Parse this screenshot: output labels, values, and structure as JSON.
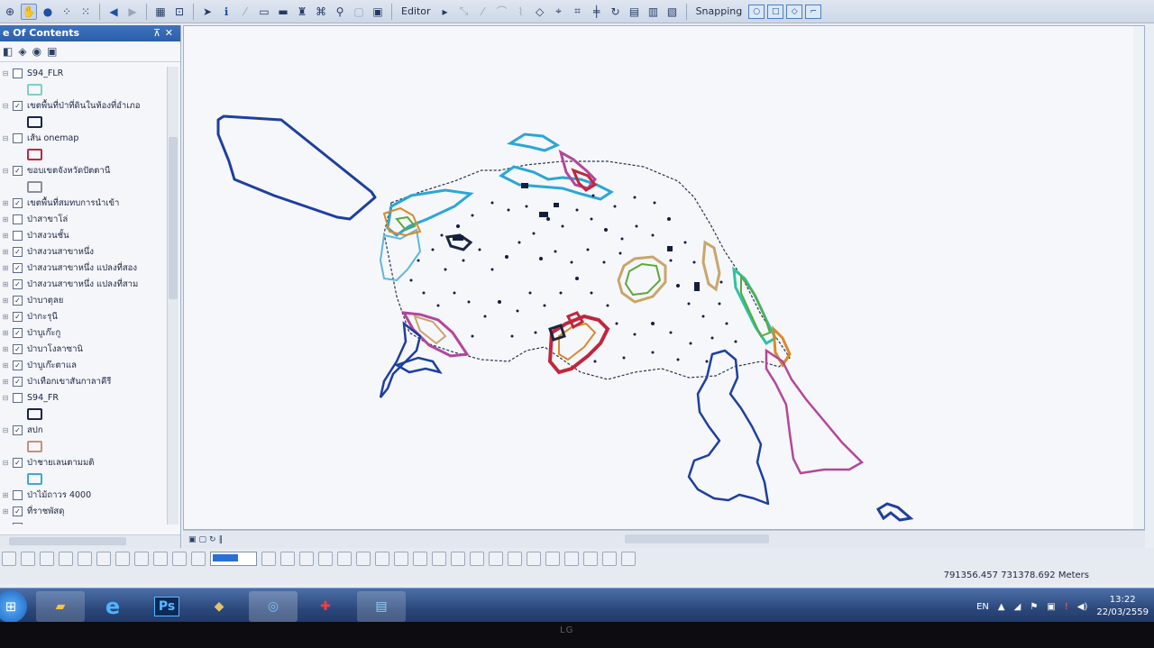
{
  "toolbar": {
    "editor_label": "Editor",
    "snapping_label": "Snapping"
  },
  "toc": {
    "title": "e Of Contents",
    "layers": [
      {
        "name": "S94_FLR",
        "checked": false,
        "symbol": "#7fd0c4"
      },
      {
        "name": "เขตพื้นที่ป่าที่ดินในท้องที่อำเภอ",
        "checked": true,
        "symbol": "#1b2540"
      },
      {
        "name": "เส้น onemap",
        "checked": false,
        "symbol": "#c0273b"
      },
      {
        "name": "ขอบเขตจังหวัดปัตตานี",
        "checked": true,
        "symbol": "#8a8f9a"
      },
      {
        "name": "เขตพื้นที่สมทบการนำเข้า",
        "checked": true
      },
      {
        "name": "ป่าสาขาโล่",
        "checked": false
      },
      {
        "name": "ป่าสงวนชั้น",
        "checked": false
      },
      {
        "name": "ป่าสงวนสาขาหนึ่ง",
        "checked": true
      },
      {
        "name": "ป่าสงวนสาขาหนึ่ง แปลงที่สอง",
        "checked": true
      },
      {
        "name": "ป่าสงวนสาขาหนึ่ง แปลงที่สาม",
        "checked": true
      },
      {
        "name": "ป่าบาตุลย",
        "checked": true
      },
      {
        "name": "ป่ากะรุนี",
        "checked": true
      },
      {
        "name": "ป่าบูเก๊ะกู",
        "checked": true
      },
      {
        "name": "ป่าบาโงลาซานิ",
        "checked": true
      },
      {
        "name": "ป่าบูเก๊ะตาแล",
        "checked": true
      },
      {
        "name": "ป่าเทือกเขาสันกาลาคีรี",
        "checked": true
      },
      {
        "name": "S94_FR",
        "checked": false,
        "symbol": "#1b2540"
      },
      {
        "name": "สปก",
        "checked": true,
        "symbol": "#c8907a"
      },
      {
        "name": "ป่าชายเลนตามมติ",
        "checked": true,
        "symbol": "#3fa8d8"
      },
      {
        "name": "ป่าไม้ถาวร 4000",
        "checked": false
      },
      {
        "name": "ที่ราชพัสดุ",
        "checked": true
      },
      {
        "name": "ขอบเขต...",
        "checked": true
      }
    ]
  },
  "map": {
    "colors": {
      "boundary_blue": "#1d3fa0",
      "mangrove_cyan": "#2aa7d6",
      "dashed_border": "#2a3350",
      "magenta": "#b4469a",
      "red": "#c0273b",
      "orange": "#d98a2a",
      "green": "#5da83a",
      "tan": "#c8a66a",
      "teal": "#2cc2a6"
    }
  },
  "status": {
    "coordinates": "791356.457  731378.692 Meters"
  },
  "taskbar": {
    "apps": [
      {
        "icon": "explorer-icon"
      },
      {
        "icon": "internet-explorer-icon",
        "label": "e"
      },
      {
        "icon": "photoshop-icon",
        "label": "Ps"
      },
      {
        "icon": "arcmap-icon"
      },
      {
        "icon": "search-globe-icon"
      },
      {
        "icon": "acrobat-icon"
      },
      {
        "icon": "image-viewer-icon"
      }
    ],
    "language": "EN",
    "time": "13:22",
    "date": "22/03/2559"
  },
  "monitor": {
    "brand": "LG"
  }
}
